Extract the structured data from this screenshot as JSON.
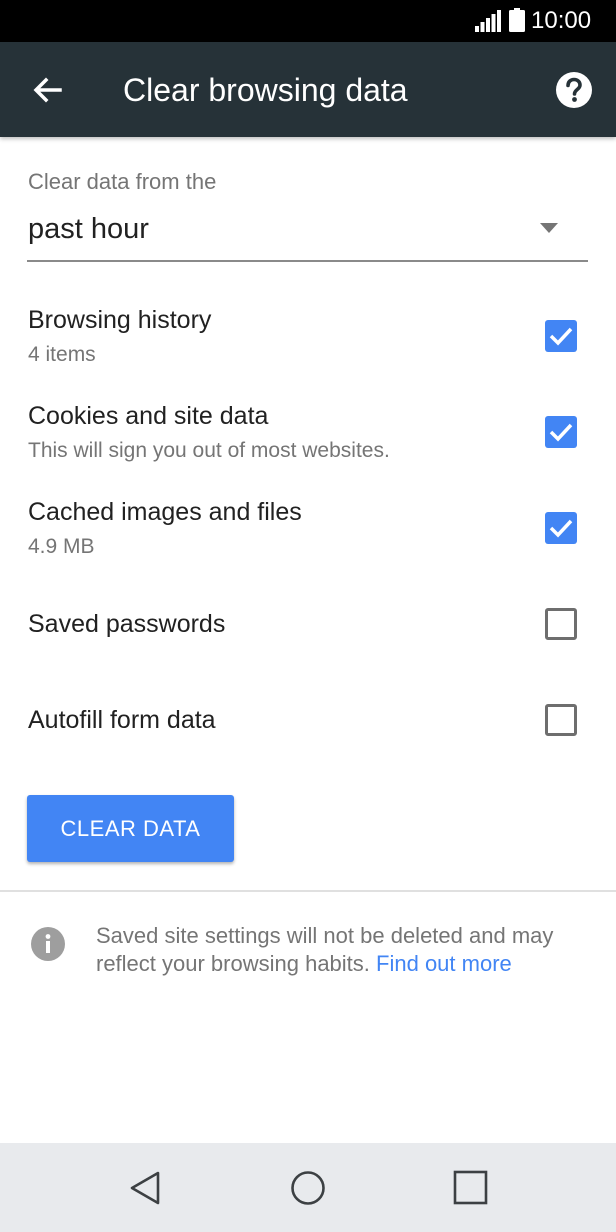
{
  "status_bar": {
    "time": "10:00",
    "signal_icon": "signal-icon",
    "battery_icon": "battery-icon"
  },
  "app_bar": {
    "title": "Clear browsing data",
    "back_icon": "back-arrow-icon",
    "help_icon": "help-icon",
    "background": "#263238"
  },
  "time_range": {
    "label": "Clear data from the",
    "selected": "past hour",
    "dropdown_icon": "dropdown-arrow-icon"
  },
  "options": [
    {
      "title": "Browsing history",
      "subtitle": "4 items",
      "checked": true
    },
    {
      "title": "Cookies and site data",
      "subtitle": "This will sign you out of most websites.",
      "checked": true
    },
    {
      "title": "Cached images and files",
      "subtitle": "4.9 MB",
      "checked": true
    },
    {
      "title": "Saved passwords",
      "subtitle": "",
      "checked": false
    },
    {
      "title": "Autofill form data",
      "subtitle": "",
      "checked": false
    }
  ],
  "clear_button": {
    "label": "CLEAR DATA"
  },
  "info": {
    "icon": "info-icon",
    "text": "Saved site settings will not be deleted and may reflect your browsing habits. ",
    "link": "Find out more"
  },
  "nav_bar": {
    "back_icon": "nav-back-icon",
    "home_icon": "nav-home-icon",
    "recents_icon": "nav-recents-icon"
  },
  "colors": {
    "accent": "#4285f4",
    "status_bar": "#000000",
    "nav_bar": "#e8eaed"
  }
}
